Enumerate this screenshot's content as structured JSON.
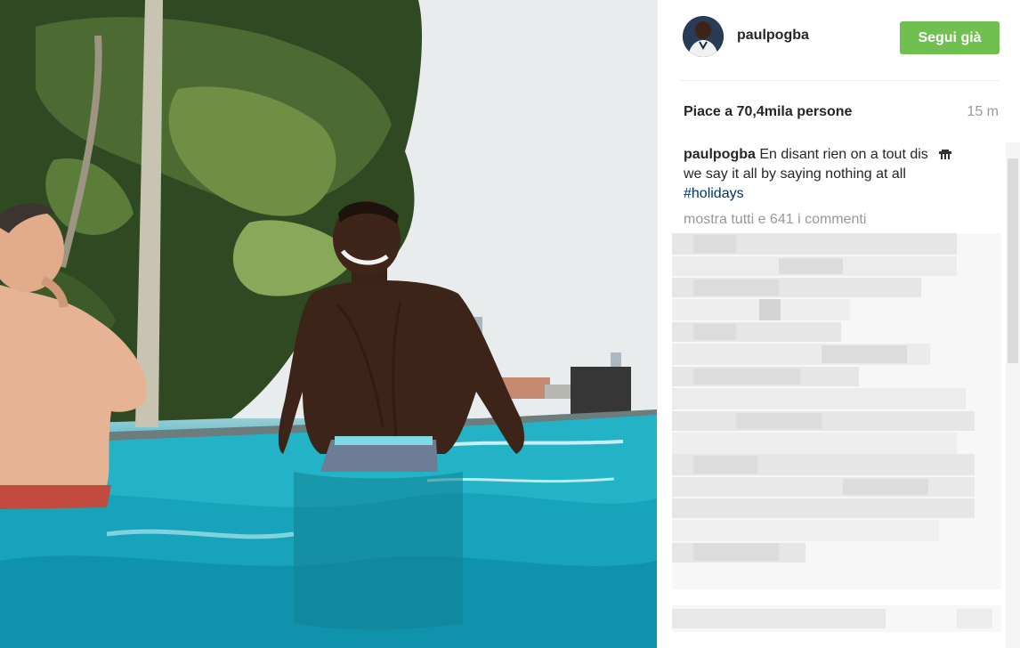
{
  "post": {
    "username": "paulpogba",
    "follow_label": "Segui già",
    "likes_text": "Piace a 70,4mila persone",
    "time_ago": "15 m",
    "caption": {
      "user": "paulpogba",
      "line1": "En disant rien on a tout dis",
      "line2": "we say it all by saying nothing at all",
      "hashtag": "#holidays",
      "emoji_icon": "hands-emoji-icon"
    },
    "view_all_comments": "mostra tutti e 641 i commenti"
  },
  "colors": {
    "follow_button": "#70c050",
    "hashtag": "#003569",
    "muted_text": "#999999"
  }
}
